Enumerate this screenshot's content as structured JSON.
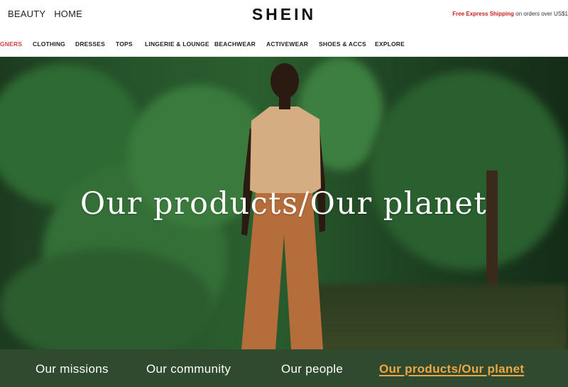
{
  "header": {
    "nav_left": [
      "BEAUTY",
      "HOME"
    ],
    "logo": "SHEIN",
    "promo_highlight": "Free Express Shipping",
    "promo_text": "on orders over US$1"
  },
  "category_nav": {
    "items": [
      "GNERS",
      "CLOTHING",
      "DRESSES",
      "TOPS",
      "LINGERIE & LOUNGE",
      "BEACHWEAR",
      "ACTIVEWEAR",
      "SHOES & ACCS",
      "EXPLORE"
    ]
  },
  "hero": {
    "title": "Our products/Our planet"
  },
  "tabs": {
    "items": [
      "Our missions",
      "Our community",
      "Our people",
      "Our products/Our planet"
    ],
    "active_index": 3
  },
  "colors": {
    "promo_accent": "#cc1f1f",
    "category_accent": "#d13f3f",
    "tabs_background": "#2f4a2e",
    "active_tab": "#f0a544"
  }
}
